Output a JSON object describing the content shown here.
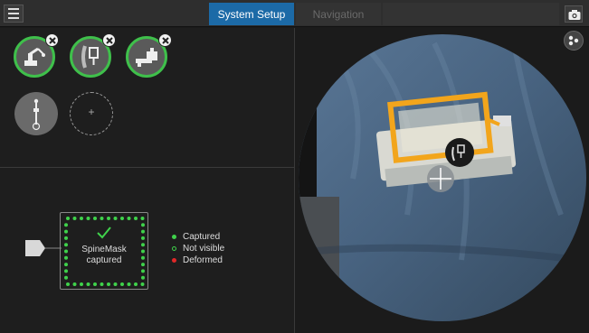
{
  "header": {
    "tabs": [
      {
        "label": "System Setup",
        "active": true
      },
      {
        "label": "Navigation",
        "active": false
      }
    ],
    "menu_icon": "hamburger-menu-icon",
    "camera_icon": "camera-icon"
  },
  "tools": {
    "registered": [
      {
        "icon": "robot-arm-tool-icon",
        "status": "connected"
      },
      {
        "icon": "spine-tracker-tool-icon",
        "status": "connected"
      },
      {
        "icon": "bed-rail-clamp-icon",
        "status": "connected"
      }
    ],
    "pending": [
      {
        "icon": "pointer-probe-icon"
      },
      {
        "icon": "add-slot-icon",
        "label": "+"
      }
    ]
  },
  "mask": {
    "status_line1": "SpineMask",
    "status_line2": "captured",
    "check_icon": "checkmark-icon"
  },
  "legend": [
    {
      "label": "Captured",
      "color": "#3fd24b"
    },
    {
      "label": "Not visible",
      "color": "#3fd24b"
    },
    {
      "label": "Deformed",
      "color": "#e02828"
    }
  ],
  "camera_view": {
    "toggle_icon": "view-toggle-icon",
    "overlay_icon": "tracker-overlay-icon",
    "crosshair": "crosshair-icon"
  },
  "colors": {
    "accent": "#1c6aa7",
    "ok": "#3fc04b",
    "error": "#e02828"
  }
}
